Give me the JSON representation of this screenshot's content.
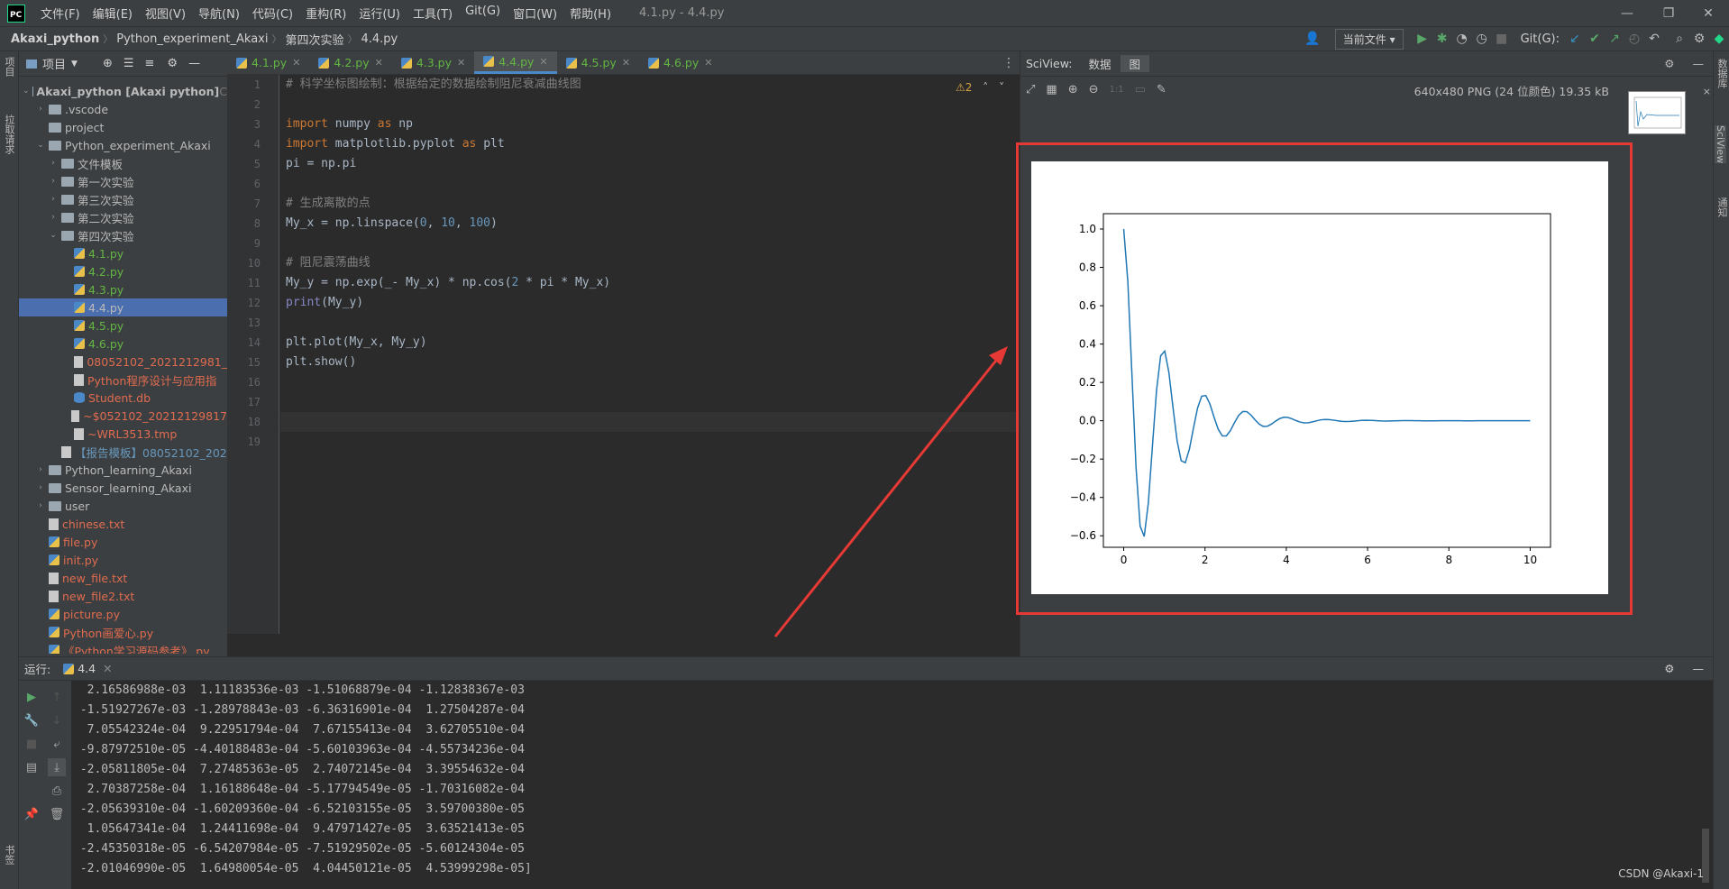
{
  "app": {
    "logo_text": "PC",
    "window_title": "4.1.py - 4.4.py",
    "menus": [
      "文件(F)",
      "编辑(E)",
      "视图(V)",
      "导航(N)",
      "代码(C)",
      "重构(R)",
      "运行(U)",
      "工具(T)",
      "Git(G)",
      "窗口(W)",
      "帮助(H)"
    ]
  },
  "breadcrumb": [
    "Akaxi_python",
    "Python_experiment_Akaxi",
    "第四次实验",
    "4.4.py"
  ],
  "toolbar": {
    "run_config": "当前文件 ▾",
    "git_label": "Git(G):"
  },
  "left_strip": {
    "project_tab": "项目",
    "pull_tab": "拉取请求",
    "bookmarks_tab": "书签"
  },
  "right_strip": {
    "db_tab": "数据库",
    "sciview_tab": "SciView",
    "notify_tab": "通知"
  },
  "project": {
    "title": "项目",
    "tree": [
      {
        "label": "Akaxi_python [Akaxi python]",
        "suffix": " C",
        "level": 0,
        "open": true,
        "kind": "folder",
        "color": "plain",
        "bold": true
      },
      {
        "label": ".vscode",
        "level": 1,
        "open": false,
        "kind": "folder",
        "color": "plain"
      },
      {
        "label": "project",
        "level": 1,
        "open": null,
        "kind": "folder",
        "color": "plain"
      },
      {
        "label": "Python_experiment_Akaxi",
        "level": 1,
        "open": true,
        "kind": "folder",
        "color": "plain"
      },
      {
        "label": "文件模板",
        "level": 2,
        "open": false,
        "kind": "folder",
        "color": "plain"
      },
      {
        "label": "第一次实验",
        "level": 2,
        "open": false,
        "kind": "folder",
        "color": "plain"
      },
      {
        "label": "第三次实验",
        "level": 2,
        "open": false,
        "kind": "folder",
        "color": "plain"
      },
      {
        "label": "第二次实验",
        "level": 2,
        "open": false,
        "kind": "folder",
        "color": "plain"
      },
      {
        "label": "第四次实验",
        "level": 2,
        "open": true,
        "kind": "folder",
        "color": "plain"
      },
      {
        "label": "4.1.py",
        "level": 3,
        "open": null,
        "kind": "py",
        "color": "green"
      },
      {
        "label": "4.2.py",
        "level": 3,
        "open": null,
        "kind": "py",
        "color": "green"
      },
      {
        "label": "4.3.py",
        "level": 3,
        "open": null,
        "kind": "py",
        "color": "green"
      },
      {
        "label": "4.4.py",
        "level": 3,
        "open": null,
        "kind": "py",
        "color": "plain",
        "selected": true
      },
      {
        "label": "4.5.py",
        "level": 3,
        "open": null,
        "kind": "py",
        "color": "green"
      },
      {
        "label": "4.6.py",
        "level": 3,
        "open": null,
        "kind": "py",
        "color": "green"
      },
      {
        "label": "08052102_2021212981_",
        "level": 3,
        "open": null,
        "kind": "txt",
        "color": "red"
      },
      {
        "label": "Python程序设计与应用指",
        "level": 3,
        "open": null,
        "kind": "txt",
        "color": "red"
      },
      {
        "label": "Student.db",
        "level": 3,
        "open": null,
        "kind": "db",
        "color": "red"
      },
      {
        "label": "~$052102_20212129817",
        "level": 3,
        "open": null,
        "kind": "txt",
        "color": "red"
      },
      {
        "label": "~WRL3513.tmp",
        "level": 3,
        "open": null,
        "kind": "txt",
        "color": "red"
      },
      {
        "label": "【报告模板】08052102_202",
        "level": 2,
        "open": null,
        "kind": "txt",
        "color": "blue"
      },
      {
        "label": "Python_learning_Akaxi",
        "level": 1,
        "open": false,
        "kind": "folder",
        "color": "plain"
      },
      {
        "label": "Sensor_learning_Akaxi",
        "level": 1,
        "open": false,
        "kind": "folder",
        "color": "plain"
      },
      {
        "label": "user",
        "level": 1,
        "open": false,
        "kind": "folder",
        "color": "plain"
      },
      {
        "label": "chinese.txt",
        "level": 1,
        "open": null,
        "kind": "txt",
        "color": "red"
      },
      {
        "label": "file.py",
        "level": 1,
        "open": null,
        "kind": "py",
        "color": "red"
      },
      {
        "label": "init.py",
        "level": 1,
        "open": null,
        "kind": "py",
        "color": "red"
      },
      {
        "label": "new_file.txt",
        "level": 1,
        "open": null,
        "kind": "txt",
        "color": "red"
      },
      {
        "label": "new_file2.txt",
        "level": 1,
        "open": null,
        "kind": "txt",
        "color": "red"
      },
      {
        "label": "picture.py",
        "level": 1,
        "open": null,
        "kind": "py",
        "color": "red"
      },
      {
        "label": "Python画爱心.py",
        "level": 1,
        "open": null,
        "kind": "py",
        "color": "red"
      },
      {
        "label": "《Python学习源码参考》.py",
        "level": 1,
        "open": null,
        "kind": "py",
        "color": "red"
      }
    ]
  },
  "editor": {
    "tabs": [
      {
        "label": "4.1.py",
        "active": false
      },
      {
        "label": "4.2.py",
        "active": false
      },
      {
        "label": "4.3.py",
        "active": false
      },
      {
        "label": "4.4.py",
        "active": true
      },
      {
        "label": "4.5.py",
        "active": false
      },
      {
        "label": "4.6.py",
        "active": false
      }
    ],
    "warning_count": "⚠2",
    "line_numbers": [
      "1",
      "2",
      "3",
      "4",
      "5",
      "6",
      "7",
      "8",
      "9",
      "10",
      "11",
      "12",
      "13",
      "14",
      "15",
      "16",
      "17",
      "18",
      "19"
    ],
    "current_line": 18,
    "lines": [
      "# 科学坐标图绘制：根据给定的数据绘制阻尼衰减曲线图",
      "",
      "import numpy as np",
      "import matplotlib.pyplot as plt",
      "pi = np.pi",
      "",
      "# 生成离散的点",
      "My_x = np.linspace(0, 10, 100)",
      "",
      "# 阻尼震荡曲线",
      "My_y = np.exp(_- My_x) * np.cos(2 * pi * My_x)",
      "print(My_y)",
      "",
      "plt.plot(My_x, My_y)",
      "plt.show()",
      "",
      "",
      "",
      ""
    ]
  },
  "sciview": {
    "label": "SciView:",
    "tabs": [
      "数据",
      "图"
    ],
    "active_tab": "图",
    "image_info": "640x480 PNG (24 位颜色) 19.35 kB"
  },
  "chart_data": {
    "type": "line",
    "function": "exp(-x)*cos(2*pi*x)",
    "x_range": [
      0,
      10
    ],
    "n_points": 100,
    "xlim": [
      -0.5,
      10.5
    ],
    "ylim": [
      -0.66,
      1.08
    ],
    "xticks": [
      "0",
      "2",
      "4",
      "6",
      "8",
      "10"
    ],
    "yticks": [
      "1.0",
      "0.8",
      "0.6",
      "0.4",
      "0.2",
      "0.0",
      "−0.2",
      "−0.4",
      "−0.6"
    ],
    "line_color": "#1f77b4"
  },
  "run": {
    "label": "运行:",
    "tab": "4.4",
    "output": [
      "  2.16586988e-03  1.11183536e-03 -1.51068879e-04 -1.12838367e-03",
      " -1.51927267e-03 -1.28978843e-03 -6.36316901e-04  1.27504287e-04",
      "  7.05542324e-04  9.22951794e-04  7.67155413e-04  3.62705510e-04",
      " -9.87972510e-05 -4.40188483e-04 -5.60103963e-04 -4.55734236e-04",
      " -2.05811805e-04  7.27485363e-05  2.74072145e-04  3.39554632e-04",
      "  2.70387258e-04  1.16188648e-04 -5.17794549e-05 -1.70316082e-04",
      " -2.05639310e-04 -1.60209360e-04 -6.52103155e-05  3.59700380e-05",
      "  1.05647341e-04  1.24411698e-04  9.47971427e-05  3.63521413e-05",
      " -2.45350318e-05 -6.54207984e-05 -7.51929502e-05 -5.60124304e-05",
      " -2.01046990e-05  1.64980054e-05  4.04450121e-05  4.53999298e-05]"
    ]
  },
  "watermark": "CSDN @Akaxi-1",
  "colors": {
    "annotation": "#e53935",
    "selection": "#4b6eaf"
  }
}
